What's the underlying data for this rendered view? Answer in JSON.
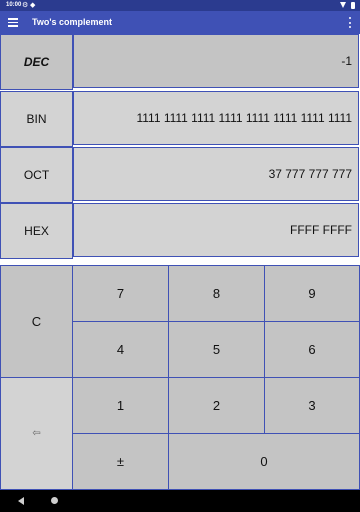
{
  "status_bar": {
    "time": "10:00",
    "settings_icon": "gear-icon",
    "shield_icon": "shield-icon",
    "wifi_icon": "wifi-icon",
    "battery_icon": "battery-icon"
  },
  "app_bar": {
    "title": "Two's complement",
    "menu_icon": "menu-icon",
    "overflow_icon": "overflow-menu-icon"
  },
  "display": {
    "rows": [
      {
        "label": "DEC",
        "value": "-1",
        "selected": true
      },
      {
        "label": "BIN",
        "value": "1111 1111 1111 1111 1111 1111 1111 1111",
        "selected": false
      },
      {
        "label": "OCT",
        "value": "37 777 777 777",
        "selected": false
      },
      {
        "label": "HEX",
        "value": "FFFF FFFF",
        "selected": false
      }
    ]
  },
  "keypad": {
    "clear": "C",
    "backspace": "⇦",
    "seven": "7",
    "eight": "8",
    "nine": "9",
    "four": "4",
    "five": "5",
    "six": "6",
    "one": "1",
    "two": "2",
    "three": "3",
    "plus_minus": "±",
    "zero": "0"
  },
  "colors": {
    "status_bar": "#2b3b8f",
    "app_bar": "#3f51b5",
    "key_border": "#3f51b5",
    "key_bg": "#c4c4c4",
    "display_bg": "#d3d3d3"
  }
}
